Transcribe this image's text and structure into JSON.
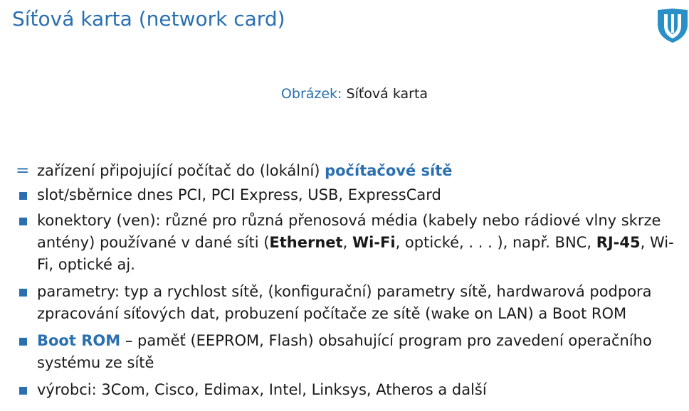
{
  "slide": {
    "title": "Síťová karta (network card)",
    "logo_icon": "university-shield-logo-icon",
    "accent_color": "#2a6fb0"
  },
  "figure": {
    "caption_label": "Obrázek:",
    "caption_text": "Síťová karta"
  },
  "items": [
    {
      "bullet": "=",
      "p1": "zařízení připojující počítač do (lokální) ",
      "hl1": "počítačové sítě"
    },
    {
      "bullet": "■",
      "p1": "slot/sběrnice dnes PCI, PCI Express, USB, ExpressCard"
    },
    {
      "bullet": "■",
      "p1": "konektory (ven): různé pro různá přenosová média (kabely nebo rádiové vlny skrze antény) používané v dané síti (",
      "b1": "Ethernet",
      "p2": ", ",
      "b2": "Wi-Fi",
      "p3": ", optické, . . . ), např. BNC, ",
      "b3": "RJ-45",
      "p4": ", Wi-Fi, optické aj."
    },
    {
      "bullet": "■",
      "p1": "parametry: typ a rychlost sítě, (konfigurační) parametry sítě, hardwarová podpora zpracování síťových dat, probuzení počítače ze sítě (wake on LAN) a Boot ROM"
    },
    {
      "bullet": "■",
      "hl1": "Boot ROM",
      "p1": " – paměť (EEPROM, Flash) obsahující program pro zavedení operačního systému ze sítě"
    },
    {
      "bullet": "■",
      "p1": "výrobci: 3Com, Cisco, Edimax, Intel, Linksys, Atheros a další"
    }
  ]
}
